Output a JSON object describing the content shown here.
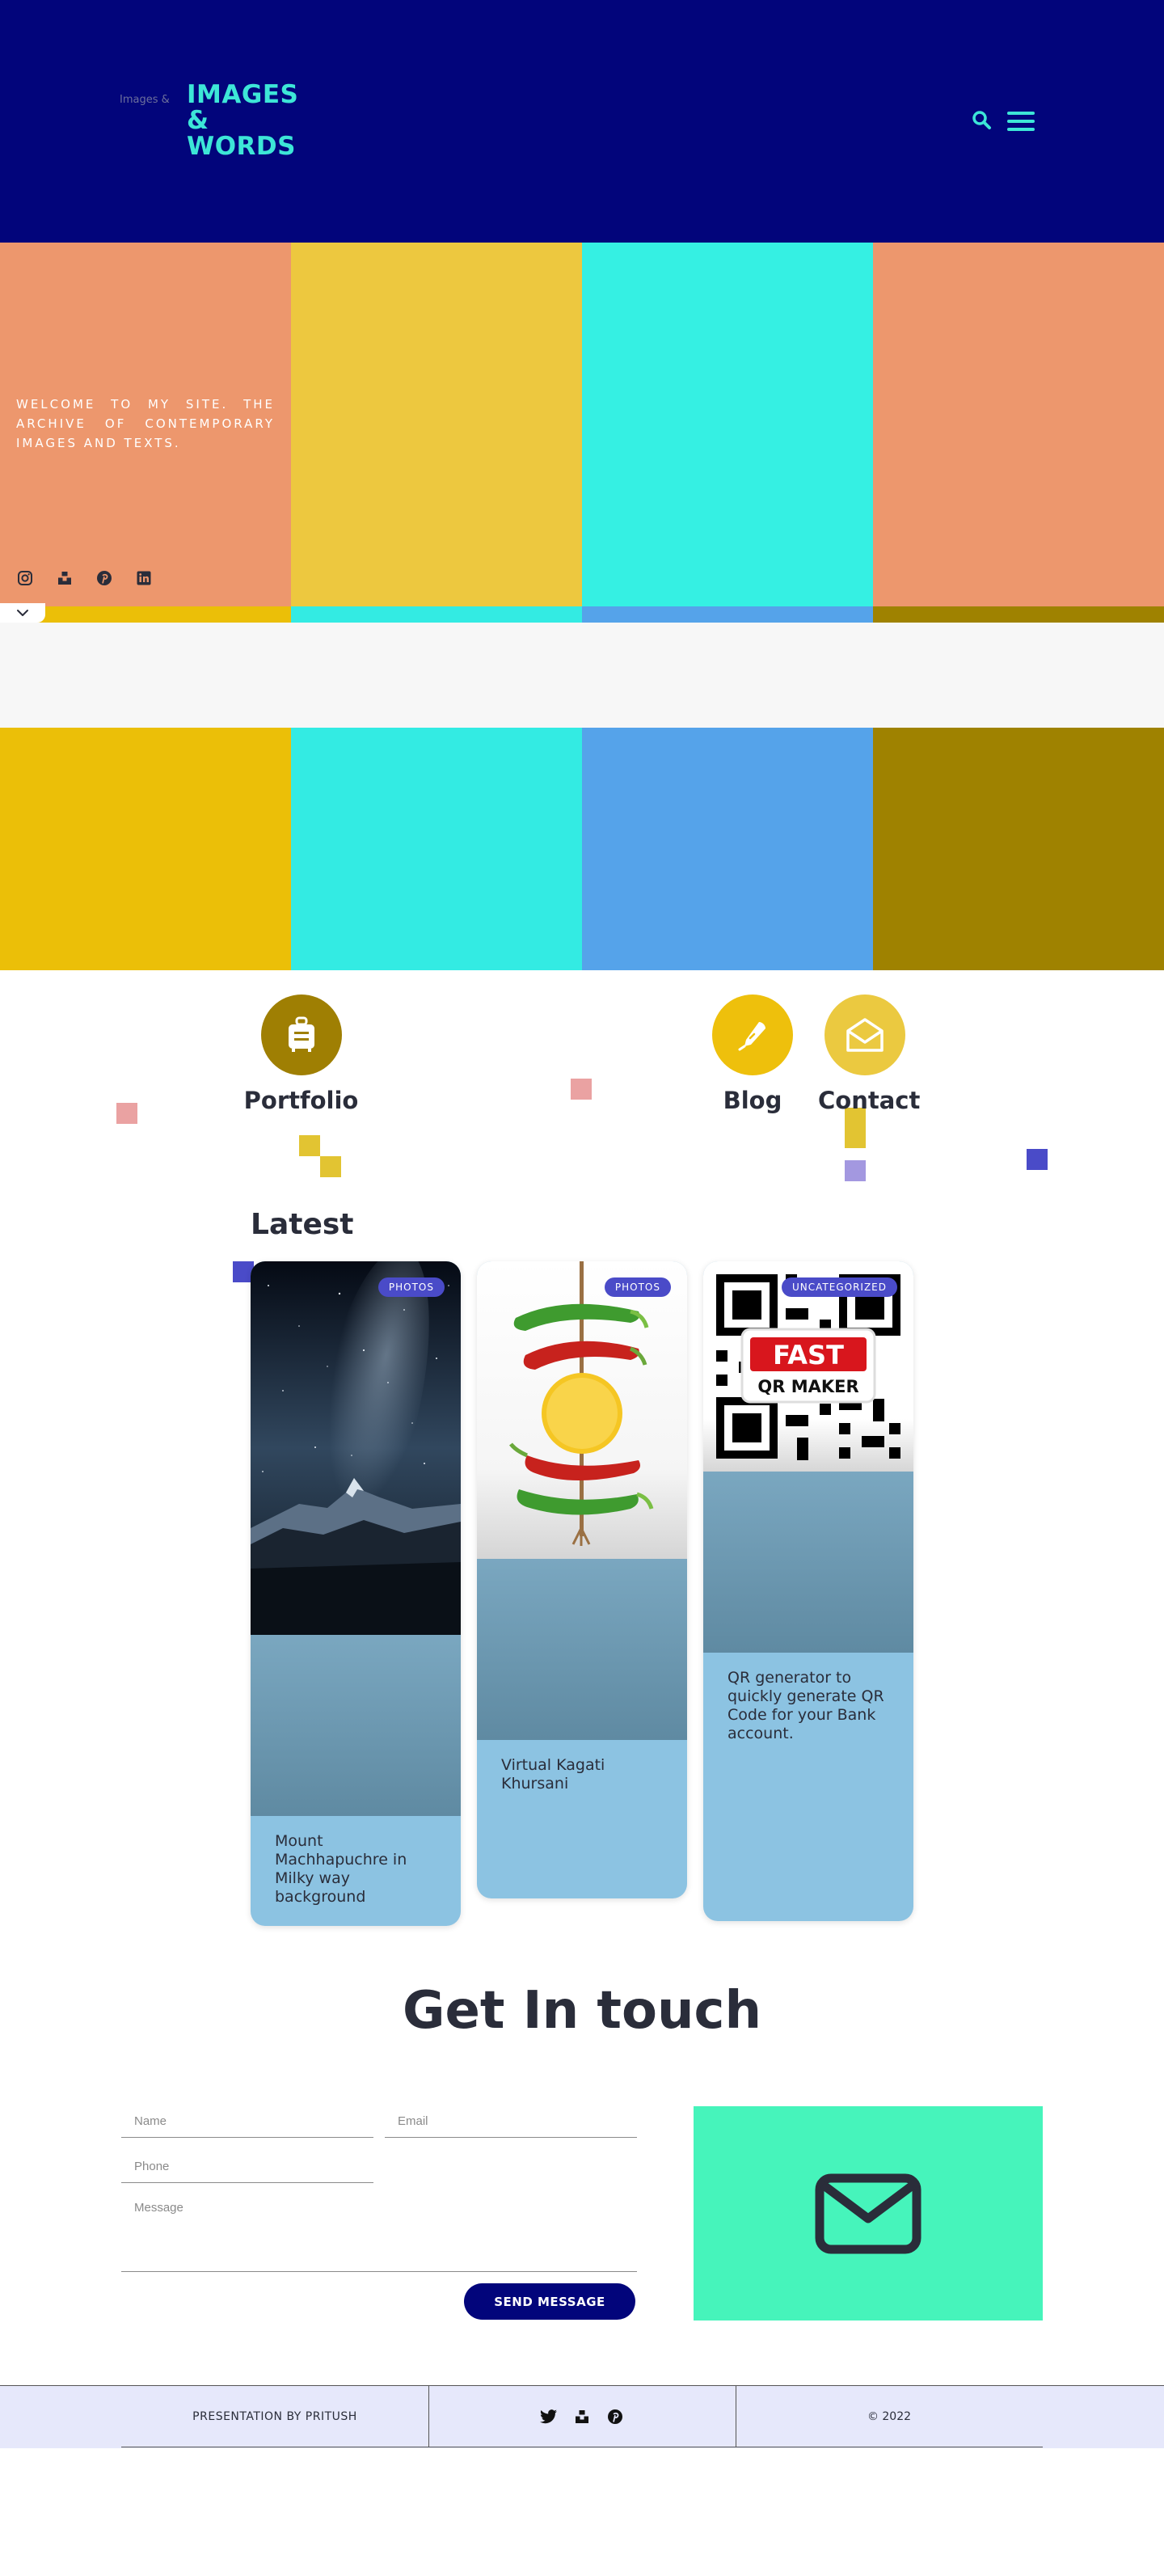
{
  "header": {
    "logo_alt": "Images & Words",
    "logo_lines": [
      "IMAGES",
      "&",
      "WORDS"
    ],
    "search_icon": "search-icon",
    "menu_icon": "hamburger-menu-icon"
  },
  "hero": {
    "welcome": "WELCOME TO MY SITE. THE ARCHIVE OF CONTEMPORARY IMAGES AND TEXTS.",
    "socials": [
      "instagram-icon",
      "unsplash-icon",
      "pinterest-icon",
      "linkedin-icon"
    ],
    "scroll_icon": "chevron-down-icon",
    "colors": {
      "salmon": "#ed976d",
      "yellow": "#edc83f",
      "aqua": "#35f0e3",
      "gold": "#ebbf08",
      "cyan": "#33ebe3",
      "blue": "#55a3ea",
      "olive": "#9f8200"
    }
  },
  "nav": {
    "items": [
      {
        "label": "Portfolio",
        "icon": "suitcase-icon",
        "color": "#9f7f03"
      },
      {
        "label": "Blog",
        "icon": "pen-icon",
        "color": "#eec00c"
      },
      {
        "label": "Contact",
        "icon": "envelope-open-icon",
        "color": "#ebc940"
      }
    ]
  },
  "latest": {
    "title": "Latest",
    "cards": [
      {
        "badge": "PHOTOS",
        "title": "Mount Machhapuchre in Milky way background",
        "image": "mountain-night-sky"
      },
      {
        "badge": "PHOTOS",
        "title": "Virtual Kagati Khursani",
        "image": "chili-lemon-skewer"
      },
      {
        "badge": "UNCATEGORIZED",
        "title": "QR generator to quickly generate QR Code for your Bank account.",
        "image": "qr-code",
        "image_lines": [
          "FAST",
          "QR MAKER"
        ]
      }
    ]
  },
  "contact": {
    "title": "Get In touch",
    "name_placeholder": "Name",
    "email_placeholder": "Email",
    "phone_placeholder": "Phone",
    "message_placeholder": "Message",
    "send_label": "SEND MESSAGE",
    "panel_icon": "envelope-icon",
    "panel_color": "#46f4bb"
  },
  "footer": {
    "credit": "PRESENTATION BY PRITUSH",
    "socials": [
      "twitter-icon",
      "unsplash-icon",
      "pinterest-icon"
    ],
    "copyright": "© 2022"
  },
  "theme": {
    "navy": "#02057b",
    "teal": "#3de6d7",
    "dark": "#2a2d3a"
  }
}
